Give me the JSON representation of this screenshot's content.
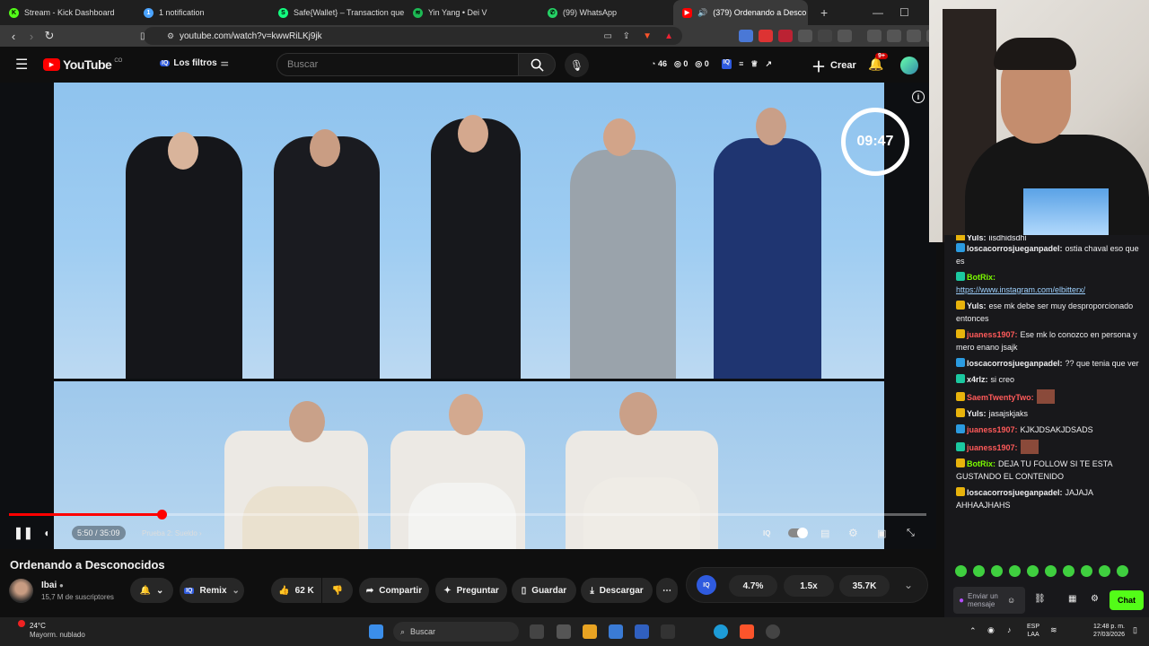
{
  "browser": {
    "tabs": [
      {
        "label": "Stream - Kick Dashboard",
        "icon": "kick-icon",
        "color": "#53fc18"
      },
      {
        "label": "1 notification",
        "icon": "notification-icon",
        "color": "#4aa3ff"
      },
      {
        "label": "Safe{Wallet} – Transaction queue",
        "icon": "safe-wallet-icon",
        "color": "#12ff80"
      },
      {
        "label": "Yin Yang • Dei V",
        "icon": "spotify-icon",
        "color": "#1db954"
      },
      {
        "label": "(99) WhatsApp",
        "icon": "whatsapp-icon",
        "color": "#25d366"
      },
      {
        "label": "(379) Ordenando a Desco",
        "icon": "youtube-icon",
        "color": "#ff0000"
      }
    ],
    "new_tab": "+",
    "url": "youtube.com/watch?v=kwwRiLKj9jk"
  },
  "youtube": {
    "logo_text": "YouTube",
    "logo_sup": "CO",
    "filter_label": "Los filtros",
    "search_placeholder": "Buscar",
    "counts": {
      "a": "46",
      "b": "0",
      "c": "0"
    },
    "create_label": "Crear",
    "notif_badge": "9+"
  },
  "video": {
    "timer": "09:47",
    "time": "5:50 / 35:09",
    "chapter": "Prueba 2: Sueldo",
    "progress": 0.166
  },
  "meta": {
    "title": "Ordenando a Desconocidos",
    "channel": "Ibai",
    "subscribers": "15,7 M de suscriptores",
    "remix": "Remix",
    "likes": "62 K",
    "share": "Compartir",
    "ask": "Preguntar",
    "save": "Guardar",
    "download": "Descargar",
    "stats": [
      "4.7%",
      "1.5x",
      "35.7K"
    ]
  },
  "chat": {
    "messages": [
      {
        "user": "Yuls:",
        "text": "jjsdhjdsdhj",
        "color": "#efeff1",
        "cut": true
      },
      {
        "user": "loscacorrosjueganpadel:",
        "text": "ostia chaval eso que es",
        "color": "#efeff1"
      },
      {
        "user": "BotRix:",
        "text": "",
        "link": "https://www.instagram.com/elbitterx/",
        "color": "#7cfc00"
      },
      {
        "user": "Yuls:",
        "text": "ese mk debe ser muy desproporcionado entonces",
        "color": "#efeff1"
      },
      {
        "user": "juaness1907:",
        "text": "Ese mk lo conozco en persona y mero enano jsajk",
        "color": "#ff5a5a"
      },
      {
        "user": "loscacorrosjueganpadel:",
        "text": "?? que tenia que ver",
        "color": "#efeff1"
      },
      {
        "user": "x4rlz:",
        "text": "si creo",
        "color": "#efeff1"
      },
      {
        "user": "SaemTwentyTwo:",
        "text": "",
        "color": "#ff5a5a",
        "emote": true
      },
      {
        "user": "Yuls:",
        "text": "jasajskjaks",
        "color": "#efeff1"
      },
      {
        "user": "juaness1907:",
        "text": "KJKJDSAKJDSADS",
        "color": "#ff5a5a"
      },
      {
        "user": "juaness1907:",
        "text": "",
        "color": "#ff5a5a",
        "emote": true
      },
      {
        "user": "BotRix:",
        "text": "DEJA TU FOLLOW SI TE ESTA GUSTANDO EL CONTENIDO",
        "color": "#7cfc00"
      },
      {
        "user": "loscacorrosjueganpadel:",
        "text": "JAJAJA AHHAAJHAHS",
        "color": "#efeff1"
      }
    ],
    "input_placeholder": "Enviar un mensaje",
    "send_label": "Chat"
  },
  "taskbar": {
    "weather_temp": "24°C",
    "weather_desc": "Mayorm. nublado",
    "search": "Buscar",
    "lang": "ESP",
    "lang2": "LAA",
    "time": "12:48 p. m.",
    "date": "27/03/2026"
  }
}
